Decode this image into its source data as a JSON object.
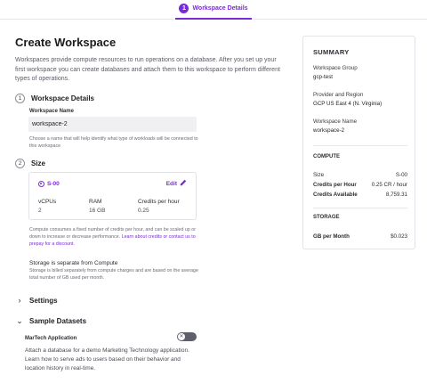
{
  "stepper": {
    "number": "1",
    "label": "Workspace Details"
  },
  "page": {
    "title": "Create Workspace",
    "intro": "Workspaces provide compute resources to run operations on a database. After you set up your first workspace you can create databases and attach them to this workspace to perform different types of operations."
  },
  "details": {
    "number": "1",
    "title": "Workspace Details",
    "field_label": "Workspace Name",
    "field_value": "workspace-2",
    "help": "Choose a name that will help identify what type of workloads will be connected to this workspace"
  },
  "size": {
    "number": "2",
    "title": "Size",
    "name": "S-00",
    "edit_label": "Edit",
    "specs": [
      {
        "label": "vCPUs",
        "value": "2"
      },
      {
        "label": "RAM",
        "value": "16 GB"
      },
      {
        "label": "Credits per hour",
        "value": "0.25"
      }
    ],
    "note_prefix": "Compute consumes a fixed number of credits per hour, and can be scaled up or down to increase or decrease performance. ",
    "note_link": "Learn about credits or contact us to prepay for a discount.",
    "storage_title": "Storage is separate from Compute",
    "storage_note": "Storage is billed separately from compute charges and are based on the average total number of GB used per month."
  },
  "settings": {
    "label": "Settings"
  },
  "datasets": {
    "label": "Sample Datasets",
    "item_label": "MarTech Application",
    "toggle_symbol": "✕",
    "item_desc": "Attach a database for a demo Marketing Technology application. Learn how to serve ads to users based on their behavior and location history in real-time."
  },
  "summary": {
    "title": "SUMMARY",
    "workspace_group_label": "Workspace Group",
    "workspace_group_value": "gcp-test",
    "provider_label": "Provider and Region",
    "provider_value": "GCP US East 4 (N. Virginia)",
    "workspace_name_label": "Workspace Name",
    "workspace_name_value": "workspace-2",
    "compute_head": "COMPUTE",
    "size_label": "Size",
    "size_value": "S-00",
    "credits_hour_label": "Credits per Hour",
    "credits_hour_value": "0.25 CR / hour",
    "credits_avail_label": "Credits Available",
    "credits_avail_value": "8,759.31",
    "storage_head": "STORAGE",
    "gb_month_label": "GB per Month",
    "gb_month_value": "$0.023"
  },
  "colors": {
    "accent": "#7a2bd6",
    "toggle_off": "#5f5f6b"
  },
  "icons": {
    "edit": "pencil-icon",
    "size": "size-icon",
    "expand": "chevron-right-icon",
    "collapse": "chevron-down-icon"
  }
}
